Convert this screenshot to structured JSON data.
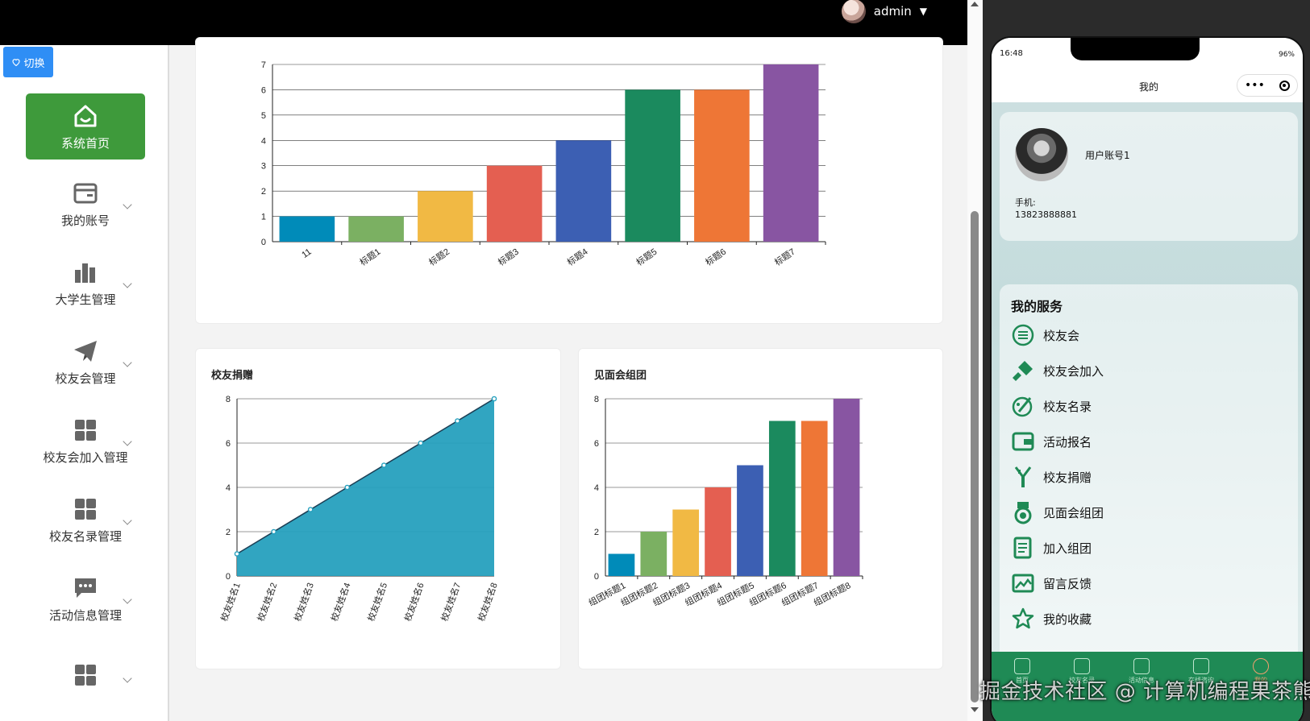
{
  "header": {
    "username": "admin"
  },
  "switch_label": "切换",
  "sidebar": {
    "items": [
      {
        "label": "系统首页",
        "icon": "home-icon",
        "active": true
      },
      {
        "label": "我的账号",
        "icon": "wallet-icon"
      },
      {
        "label": "大学生管理",
        "icon": "bar-chart-icon"
      },
      {
        "label": "校友会管理",
        "icon": "send-icon"
      },
      {
        "label": "校友会加入管理",
        "icon": "grid-icon"
      },
      {
        "label": "校友名录管理",
        "icon": "grid-icon"
      },
      {
        "label": "活动信息管理",
        "icon": "message-icon"
      },
      {
        "label": "",
        "icon": "grid-icon"
      }
    ]
  },
  "charts": {
    "donation_title": "校友捐赠",
    "group_title": "见面会组团"
  },
  "chart_data": [
    {
      "type": "bar",
      "title": "",
      "categories": [
        "11",
        "标题1",
        "标题2",
        "标题3",
        "标题4",
        "标题5",
        "标题6",
        "标题7"
      ],
      "values": [
        1,
        1,
        2,
        3,
        4,
        6,
        6,
        7
      ],
      "ylim": [
        0,
        7
      ],
      "yticks": [
        0,
        1,
        2,
        3,
        4,
        5,
        6,
        7
      ],
      "colors": [
        "#008bb9",
        "#7bb062",
        "#f1b944",
        "#e45f51",
        "#3c5fb3",
        "#1b8a5e",
        "#ee7636",
        "#8855a2"
      ]
    },
    {
      "type": "area",
      "title": "校友捐赠",
      "categories": [
        "校友姓名1",
        "校友姓名2",
        "校友姓名3",
        "校友姓名4",
        "校友姓名5",
        "校友姓名6",
        "校友姓名7",
        "校友姓名8"
      ],
      "values": [
        1,
        2,
        3,
        4,
        5,
        6,
        7,
        8
      ],
      "ylim": [
        0,
        8
      ],
      "yticks": [
        0,
        2,
        4,
        6,
        8
      ],
      "colors": [
        "#26a0be"
      ]
    },
    {
      "type": "bar",
      "title": "见面会组团",
      "categories": [
        "组团标题1",
        "组团标题2",
        "组团标题3",
        "组团标题4",
        "组团标题5",
        "组团标题6",
        "组团标题7",
        "组团标题8"
      ],
      "values": [
        1,
        2,
        3,
        4,
        5,
        7,
        7,
        8
      ],
      "ylim": [
        0,
        8
      ],
      "yticks": [
        0,
        2,
        4,
        6,
        8
      ],
      "colors": [
        "#008bb9",
        "#7bb062",
        "#f1b944",
        "#e45f51",
        "#3c5fb3",
        "#1b8a5e",
        "#ee7636",
        "#8855a2"
      ]
    }
  ],
  "phone": {
    "time": "16:48",
    "battery": "96%",
    "nav_title": "我的",
    "capsule_dots": "•••",
    "profile": {
      "name": "用户账号1",
      "phone_label": "手机:",
      "phone": "13823888881"
    },
    "services_title": "我的服务",
    "services": [
      {
        "label": "校友会",
        "icon": "list-circle-icon"
      },
      {
        "label": "校友会加入",
        "icon": "stamp-icon"
      },
      {
        "label": "校友名录",
        "icon": "palette-icon"
      },
      {
        "label": "活动报名",
        "icon": "wallet-icon"
      },
      {
        "label": "校友捐赠",
        "icon": "fork-icon"
      },
      {
        "label": "见面会组团",
        "icon": "medal-icon"
      },
      {
        "label": "加入组团",
        "icon": "document-icon"
      },
      {
        "label": "留言反馈",
        "icon": "picture-icon"
      },
      {
        "label": "我的收藏",
        "icon": "star-icon"
      }
    ],
    "tabs": [
      {
        "label": "首页"
      },
      {
        "label": "校友名录"
      },
      {
        "label": "活动信息"
      },
      {
        "label": "在线咨询"
      },
      {
        "label": "我的"
      }
    ],
    "accent": "#1f8a55"
  },
  "watermark": "掘金技术社区 @ 计算机编程果茶熊"
}
